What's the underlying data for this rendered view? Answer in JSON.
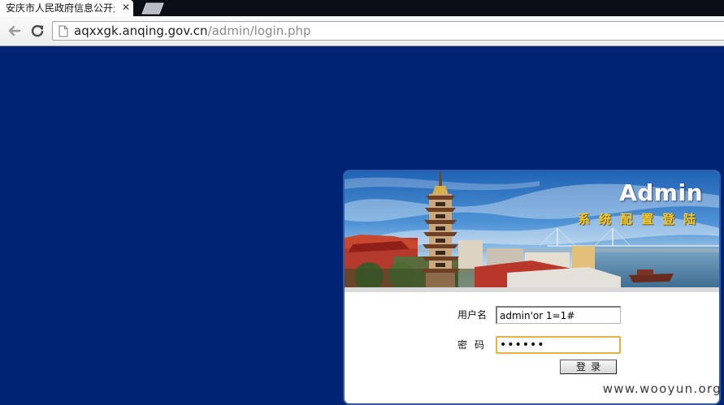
{
  "browser": {
    "tab_title": "安庆市人民政府信息公开光",
    "close_glyph": "✕",
    "url_host": "aqxxgk.anqing.gov.cn",
    "url_path": "/admin/login.php"
  },
  "banner": {
    "title": "Admin",
    "subtitle": "系统配置登陆"
  },
  "form": {
    "username_label": "用户名",
    "username_value": "admin'or 1=1#",
    "password_label": "密码",
    "password_value": "••••••",
    "submit_label": "登录"
  },
  "watermark": "www.wooyun.org",
  "colors": {
    "page_background": "#012374",
    "panel_border": "#2f5aa6",
    "focus_border": "#e3b243",
    "subtitle": "#f3c92f"
  }
}
